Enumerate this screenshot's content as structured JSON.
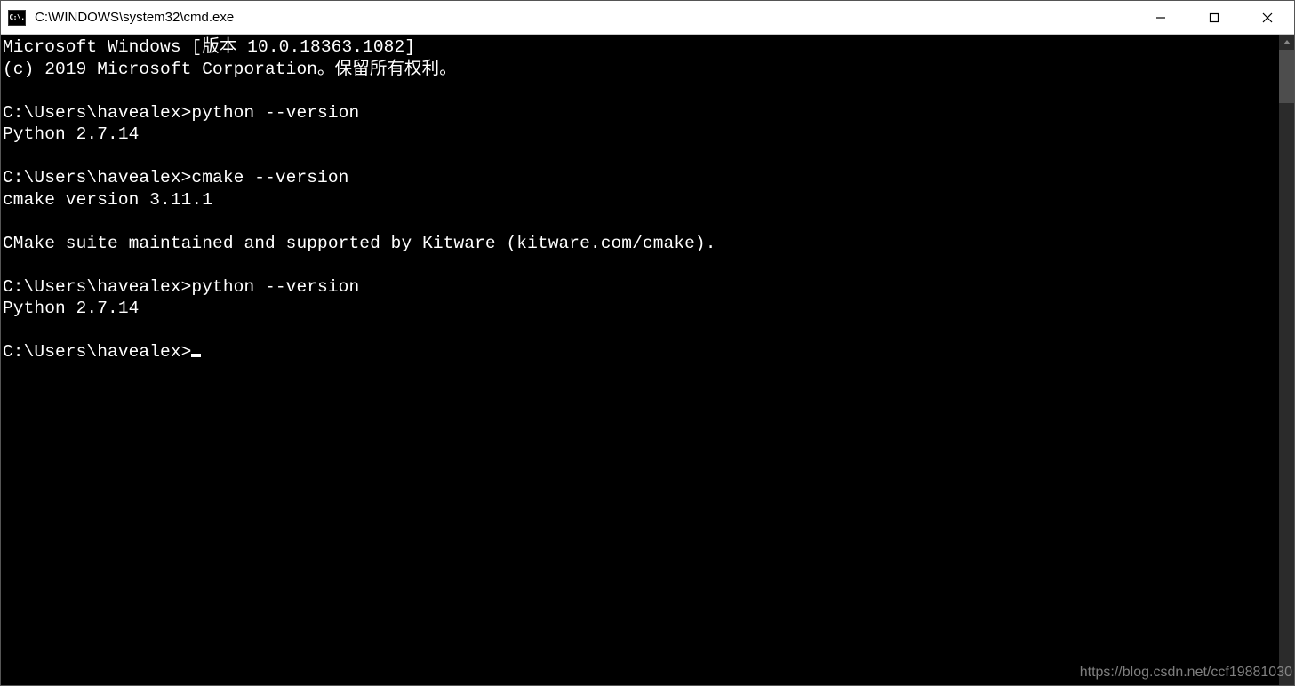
{
  "titlebar": {
    "icon_text": "C:\\.",
    "title": "C:\\WINDOWS\\system32\\cmd.exe"
  },
  "terminal": {
    "lines": [
      "Microsoft Windows [版本 10.0.18363.1082]",
      "(c) 2019 Microsoft Corporation。保留所有权利。",
      "",
      "C:\\Users\\havealex>python --version",
      "Python 2.7.14",
      "",
      "C:\\Users\\havealex>cmake --version",
      "cmake version 3.11.1",
      "",
      "CMake suite maintained and supported by Kitware (kitware.com/cmake).",
      "",
      "C:\\Users\\havealex>python --version",
      "Python 2.7.14",
      "",
      "C:\\Users\\havealex>"
    ]
  },
  "watermark": "https://blog.csdn.net/ccf19881030"
}
